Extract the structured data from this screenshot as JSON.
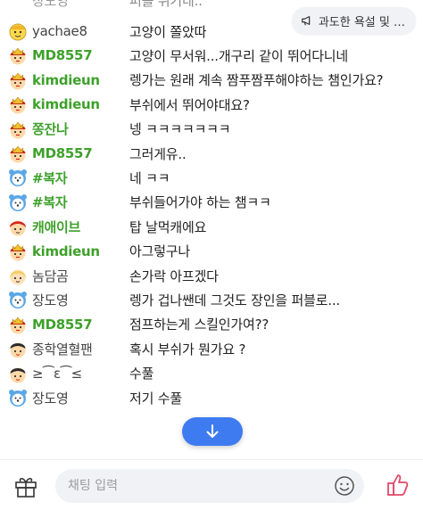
{
  "top_cutoff": {
    "nick": "장도영",
    "msg": "퍼플 뛰기네.."
  },
  "notice": {
    "label": "과도한 욕설 및 …"
  },
  "messages": [
    {
      "nick": "yachae8",
      "msg": "고양이 쫄았따",
      "style": "plain",
      "avatar": "yellow-face"
    },
    {
      "nick": "MD8557",
      "msg": "고양이 무서워...개구리 같이 뛰어다니네",
      "style": "green",
      "avatar": "crown-face"
    },
    {
      "nick": "kimdieun",
      "msg": "렝가는 원래 계속 짬푸짬푸해야하는 챔인가요?",
      "style": "green",
      "avatar": "crown-face"
    },
    {
      "nick": "kimdieun",
      "msg": "부쉬에서 뛰어야대요?",
      "style": "green",
      "avatar": "crown-face"
    },
    {
      "nick": "쫑잔나",
      "msg": "넹 ㅋㅋㅋㅋㅋㅋㅋ",
      "style": "green",
      "avatar": "crown-face"
    },
    {
      "nick": "MD8557",
      "msg": "그러게유..",
      "style": "green",
      "avatar": "crown-face"
    },
    {
      "nick": "#복자",
      "msg": "네 ㅋㅋ",
      "style": "green",
      "avatar": "blue-bear"
    },
    {
      "nick": "#복자",
      "msg": "부쉬들어가야 하는 챔ㅋㅋ",
      "style": "green",
      "avatar": "blue-bear"
    },
    {
      "nick": "캐애이브",
      "msg": "탑 날먹캐에요",
      "style": "green",
      "avatar": "red-hair"
    },
    {
      "nick": "kimdieun",
      "msg": "아그렇구나",
      "style": "green",
      "avatar": "crown-face"
    },
    {
      "nick": "놈담곰",
      "msg": "손가락 아프겠다",
      "style": "plain",
      "avatar": "blonde"
    },
    {
      "nick": "장도영",
      "msg": "렝가 겁나쌘데 그것도 장인을 퍼블로...",
      "style": "plain",
      "avatar": "blue-bear"
    },
    {
      "nick": "MD8557",
      "msg": "점프하는게 스킬인가여??",
      "style": "green",
      "avatar": "crown-face"
    },
    {
      "nick": "종학열혈팬",
      "msg": "혹시 부쉬가 뭔가요 ?",
      "style": "plain",
      "avatar": "dark-hair"
    },
    {
      "nick": "≥⁀ε⁀≤",
      "msg": "수풀",
      "style": "plain",
      "avatar": "dark-hair"
    },
    {
      "nick": "장도영",
      "msg": "저기 수풀",
      "style": "plain",
      "avatar": "blue-bear"
    }
  ],
  "input": {
    "placeholder": "채팅 입력"
  },
  "colors": {
    "accent": "#3e7bf0",
    "nick_green": "#3ea12b"
  }
}
